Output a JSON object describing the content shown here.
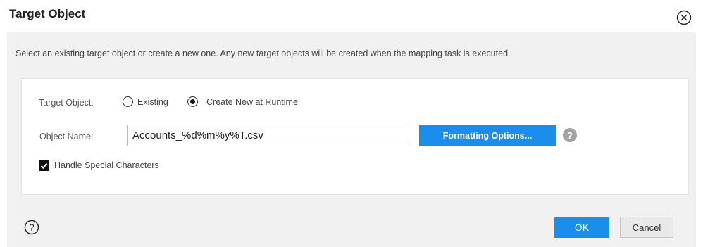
{
  "dialog": {
    "title": "Target Object",
    "description": "Select an existing target object or create a new one. Any new target objects will be created when the mapping task is executed."
  },
  "form": {
    "target_object_label": "Target Object:",
    "radio_existing": {
      "label": "Existing",
      "checked": false
    },
    "radio_create_new": {
      "label": "Create New at Runtime",
      "checked": true
    },
    "object_name_label": "Object Name:",
    "object_name_value": "Accounts_%d%m%y%T.csv",
    "formatting_button": "Formatting Options...",
    "info_icon_glyph": "?",
    "handle_special_chars": {
      "label": "Handle Special Characters",
      "checked": true
    }
  },
  "footer": {
    "ok_label": "OK",
    "cancel_label": "Cancel"
  },
  "icons": {
    "close": "close-circle-icon",
    "help": "help-circle-icon",
    "info": "info-question-icon",
    "check": "checkmark-icon"
  },
  "colors": {
    "accent": "#1a8eea",
    "body_bg": "#f1f1f2",
    "info_icon": "#a3a3a3"
  }
}
